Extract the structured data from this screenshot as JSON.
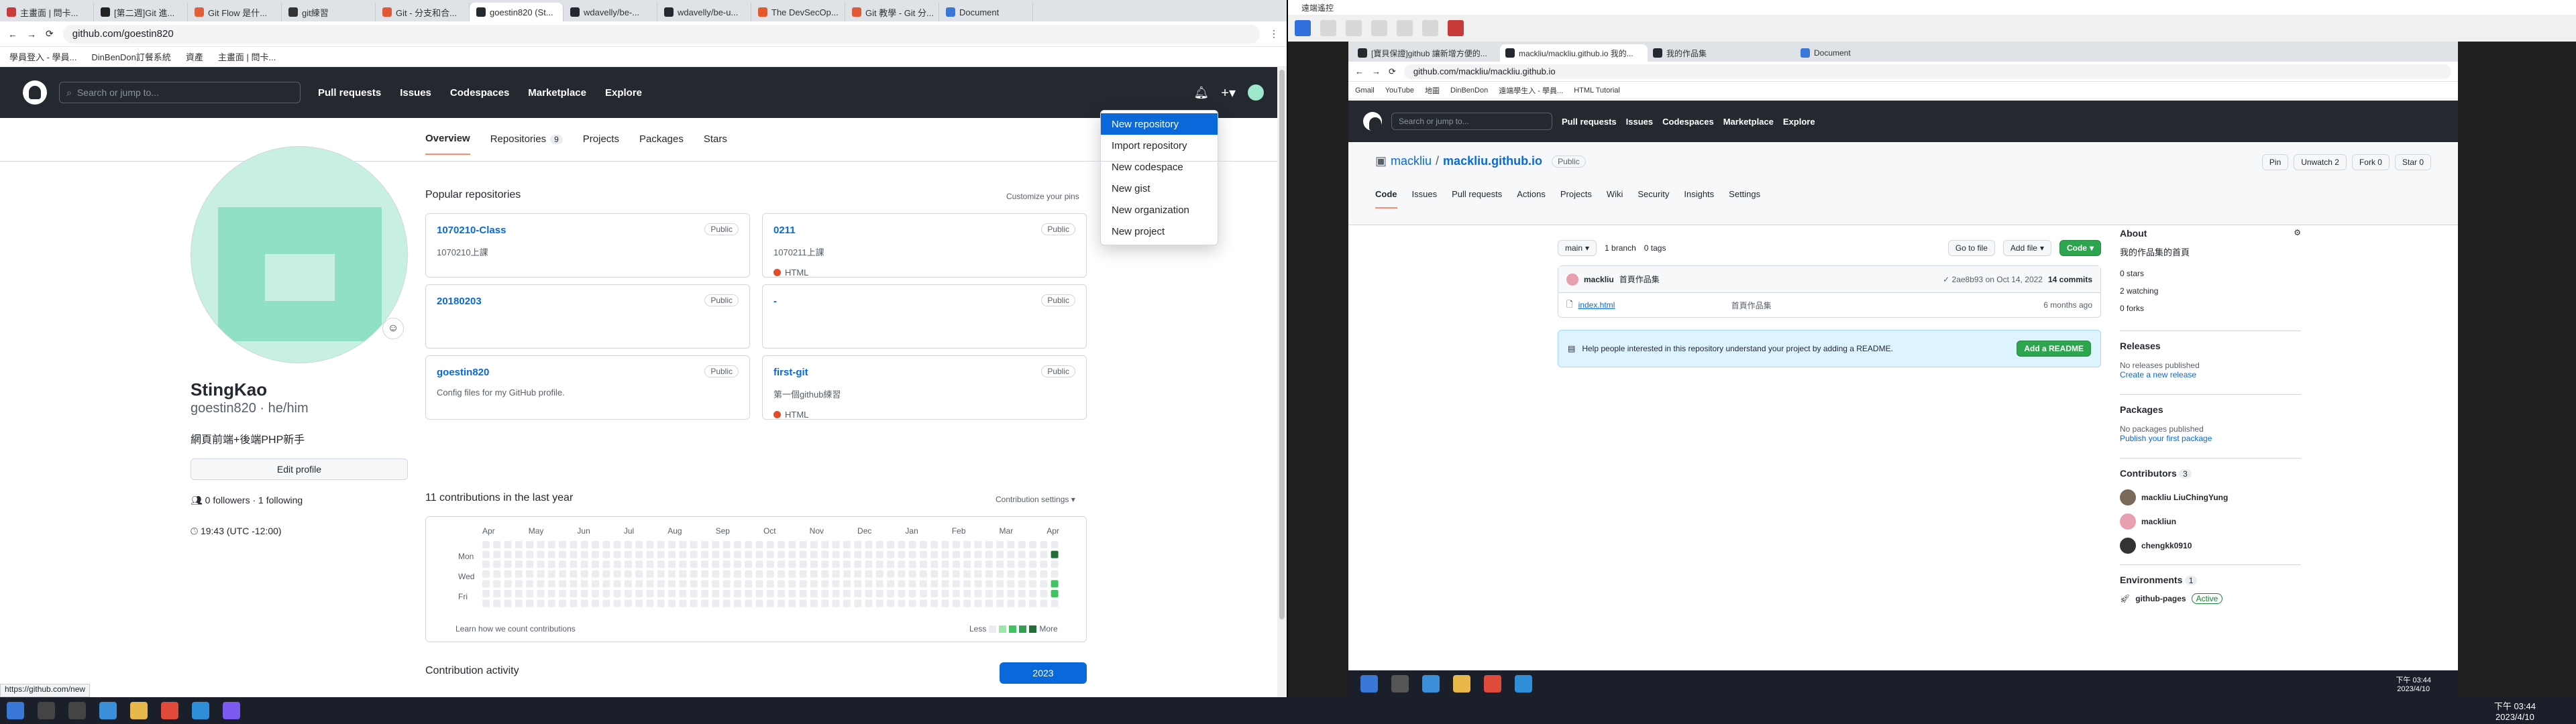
{
  "left": {
    "tabs": [
      "主畫面 | 問卡...",
      "[第二週]Git 進...",
      "Git Flow 是什...",
      "git練習",
      "Git - 分支和合...",
      "goestin820 (St...",
      "wdavelly/be-...",
      "wdavelly/be-u...",
      "The DevSecOp...",
      "Git 教學 - Git 分...",
      "Document"
    ],
    "active_tab": 5,
    "url": "github.com/goestin820",
    "bookmarks": [
      "學員登入 - 學員...",
      "DinBenDon訂餐系統",
      "資產",
      "主畫面 | 問卡..."
    ],
    "gh_nav": [
      "Pull requests",
      "Issues",
      "Codespaces",
      "Marketplace",
      "Explore"
    ],
    "search_placeholder": "Search or jump to...",
    "create_menu": [
      "New repository",
      "Import repository",
      "New codespace",
      "New gist",
      "New organization",
      "New project"
    ],
    "profile_tabs": [
      {
        "label": "Overview"
      },
      {
        "label": "Repositories",
        "count": "9"
      },
      {
        "label": "Projects"
      },
      {
        "label": "Packages"
      },
      {
        "label": "Stars"
      }
    ],
    "name": "StingKao",
    "handle": "goestin820 · he/him",
    "bio": "網頁前端+後端PHP新手",
    "edit_profile": "Edit profile",
    "followers": "0 followers · 1 following",
    "time": "19:43 (UTC -12:00)",
    "popular_title": "Popular repositories",
    "customize": "Customize your pins",
    "repos": [
      {
        "name": "1070210-Class",
        "vis": "Public",
        "desc": "1070210上課",
        "lang": ""
      },
      {
        "name": "0211",
        "vis": "Public",
        "desc": "1070211上課",
        "lang": "HTML"
      },
      {
        "name": "20180203",
        "vis": "Public",
        "desc": "",
        "lang": ""
      },
      {
        "name": "-",
        "vis": "Public",
        "desc": "",
        "lang": ""
      },
      {
        "name": "goestin820",
        "vis": "Public",
        "desc": "Config files for my GitHub profile.",
        "lang": ""
      },
      {
        "name": "first-git",
        "vis": "Public",
        "desc": "第一個github練習",
        "lang": "HTML"
      }
    ],
    "contrib_title": "11 contributions in the last year",
    "contrib_settings": "Contribution settings ▾",
    "months": [
      "Apr",
      "May",
      "Jun",
      "Jul",
      "Aug",
      "Sep",
      "Oct",
      "Nov",
      "Dec",
      "Jan",
      "Feb",
      "Mar",
      "Apr"
    ],
    "days": [
      "Mon",
      "Wed",
      "Fri"
    ],
    "learn": "Learn how we count contributions",
    "less": "Less",
    "more": "More",
    "activity": "Contribution activity",
    "year": "2023",
    "status_url": "https://github.com/new"
  },
  "right": {
    "window_title": "遠端遙控",
    "tabs": [
      "[寶貝保證]github 讓新增方便的...",
      "mackliu/mackliu.github.io 我的...",
      "我的作品集",
      "Document"
    ],
    "url": "github.com/mackliu/mackliu.github.io",
    "bookmarks": [
      "Gmail",
      "YouTube",
      "地圖",
      "DinBenDon",
      "遠端學生入 - 學員...",
      "HTML Tutorial"
    ],
    "search_placeholder": "Search or jump to...",
    "gh_nav": [
      "Pull requests",
      "Issues",
      "Codespaces",
      "Marketplace",
      "Explore"
    ],
    "owner": "mackliu",
    "sep": " / ",
    "repo": "mackliu.github.io",
    "vis": "Public",
    "actions": [
      "Pin",
      "Unwatch 2",
      "Fork 0",
      "Star 0"
    ],
    "repo_tabs": [
      "Code",
      "Issues",
      "Pull requests",
      "Actions",
      "Projects",
      "Wiki",
      "Security",
      "Insights",
      "Settings"
    ],
    "branch": "main",
    "branches": "1 branch",
    "tags": "0 tags",
    "goto": "Go to file",
    "addfile": "Add file",
    "code": "Code",
    "commit_author": "mackliu",
    "commit_msg": "首頁作品集",
    "commit_meta": "✓ 2ae8b93 on Oct 14, 2022",
    "commits": "14 commits",
    "file": "index.html",
    "file_msg": "首頁作品集",
    "file_time": "6 months ago",
    "readme_msg": "Help people interested in this repository understand your project by adding a README.",
    "readme_btn": "Add a README",
    "about": "About",
    "about_desc": "我的作品集的首頁",
    "stats": [
      "0 stars",
      "2 watching",
      "0 forks"
    ],
    "releases": "Releases",
    "no_releases": "No releases published",
    "create_release": "Create a new release",
    "packages": "Packages",
    "no_packages": "No packages published",
    "publish_pkg": "Publish your first package",
    "contributors": "Contributors",
    "contrib_count": "3",
    "contrib_list": [
      "mackliu LiuChingYung",
      "mackliun",
      "chengkk0910"
    ],
    "envs": "Environments",
    "env_count": "1",
    "env": "github-pages",
    "env_state": "Active",
    "clock": "下午 03:44",
    "date": "2023/4/10"
  },
  "taskbar": {
    "clock": "下午 03:44",
    "date": "2023/4/10"
  }
}
